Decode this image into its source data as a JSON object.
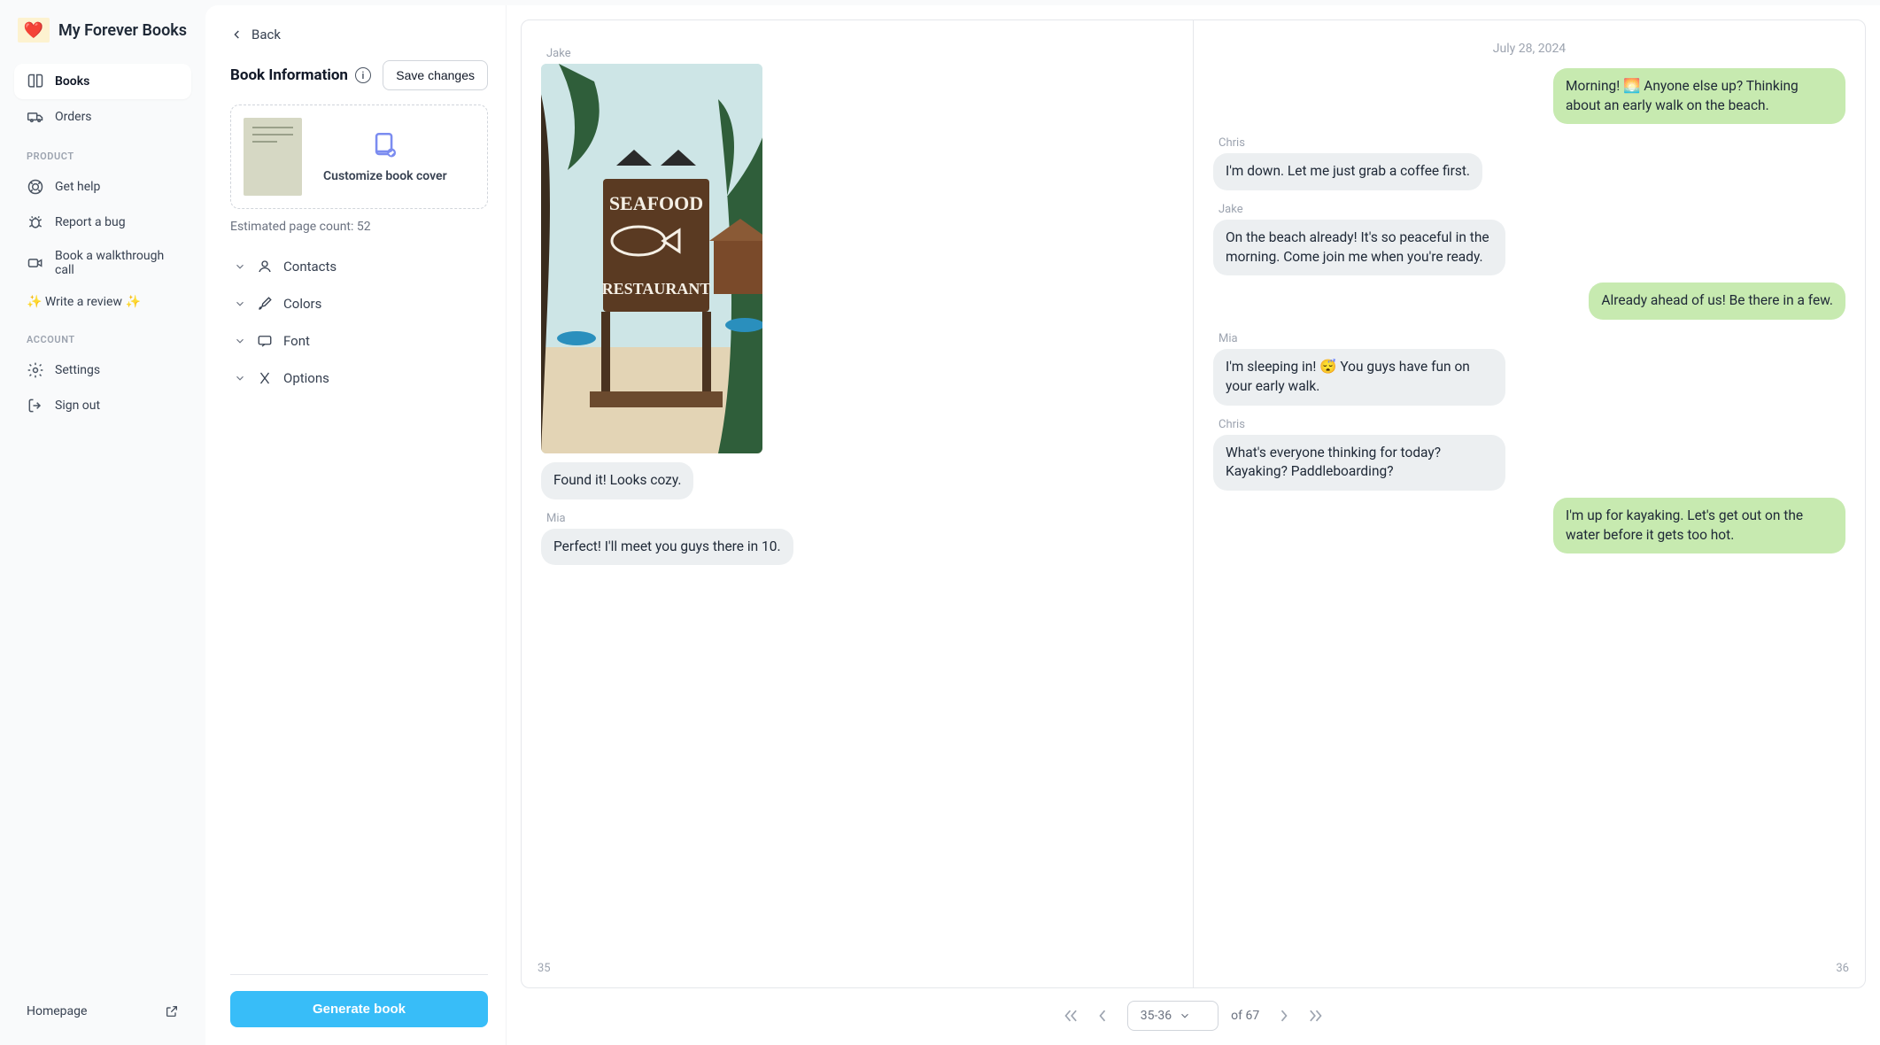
{
  "brand": {
    "name": "My Forever Books"
  },
  "sidebar": {
    "nav": [
      {
        "label": "Books",
        "active": true
      },
      {
        "label": "Orders"
      }
    ],
    "product_label": "PRODUCT",
    "product": [
      {
        "label": "Get help"
      },
      {
        "label": "Report a bug"
      },
      {
        "label": "Book a walkthrough call"
      },
      {
        "label": "✨ Write a review ✨"
      }
    ],
    "account_label": "ACCOUNT",
    "account": [
      {
        "label": "Settings"
      },
      {
        "label": "Sign out"
      }
    ],
    "homepage": "Homepage"
  },
  "editor": {
    "back": "Back",
    "title": "Book Information",
    "save": "Save changes",
    "cover_cta": "Customize book cover",
    "estimated": "Estimated page count: 52",
    "accordion": [
      {
        "label": "Contacts"
      },
      {
        "label": "Colors"
      },
      {
        "label": "Font"
      },
      {
        "label": "Options"
      }
    ],
    "generate": "Generate book"
  },
  "spread": {
    "left": {
      "page_number": "35",
      "items": [
        {
          "kind": "sender",
          "text": "Jake"
        },
        {
          "kind": "photo"
        },
        {
          "kind": "bubble_in",
          "text": "Found it! Looks cozy."
        },
        {
          "kind": "sender",
          "text": "Mia"
        },
        {
          "kind": "bubble_in",
          "text": "Perfect! I'll meet you guys there in 10."
        }
      ]
    },
    "right": {
      "page_number": "36",
      "date": "July 28, 2024",
      "items": [
        {
          "kind": "bubble_out",
          "text": "Morning! 🌅 Anyone else up? Thinking about an early walk on the beach."
        },
        {
          "kind": "sender",
          "text": "Chris"
        },
        {
          "kind": "bubble_in",
          "text": "I'm down. Let me just grab a coffee first."
        },
        {
          "kind": "sender",
          "text": "Jake"
        },
        {
          "kind": "bubble_in",
          "text": "On the beach already! It's so peaceful in the morning. Come join me when you're ready."
        },
        {
          "kind": "bubble_out",
          "text": "Already ahead of us! Be there in a few."
        },
        {
          "kind": "sender",
          "text": "Mia"
        },
        {
          "kind": "bubble_in",
          "text": "I'm sleeping in! 😴 You guys have fun on your early walk."
        },
        {
          "kind": "sender",
          "text": "Chris"
        },
        {
          "kind": "bubble_in",
          "text": "What's everyone thinking for today? Kayaking? Paddleboarding?"
        },
        {
          "kind": "bubble_out",
          "text": "I'm up for kayaking. Let's get out on the water before it gets too hot."
        }
      ]
    }
  },
  "pager": {
    "current": "35-36",
    "of": "of 67"
  }
}
